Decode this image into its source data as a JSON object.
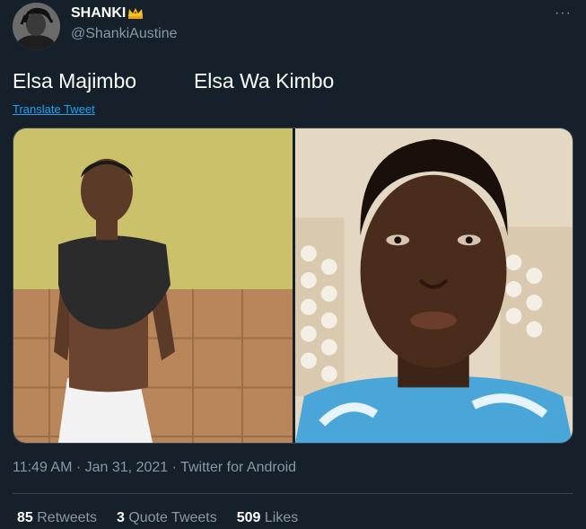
{
  "author": {
    "display_name": "SHANKI",
    "handle": "@ShankiAustine",
    "badge_icon": "crown-icon"
  },
  "tweet": {
    "text": "Elsa Majimbo          Elsa Wa Kimbo",
    "translate_label": "Translate Tweet",
    "more_icon": "more-options-icon",
    "more_label": "···"
  },
  "meta": {
    "time": "11:49 AM",
    "sep1": " · ",
    "date": "Jan 31, 2021",
    "sep2": " · ",
    "source": "Twitter for Android"
  },
  "stats": {
    "retweets_count": "85",
    "retweets_label": "Retweets",
    "quotes_count": "3",
    "quotes_label": "Quote Tweets",
    "likes_count": "509",
    "likes_label": "Likes"
  },
  "colors": {
    "background": "#15202b",
    "primary_text": "#ffffff",
    "secondary_text": "#8899a6",
    "link": "#1da1f2",
    "border": "#38444d"
  }
}
